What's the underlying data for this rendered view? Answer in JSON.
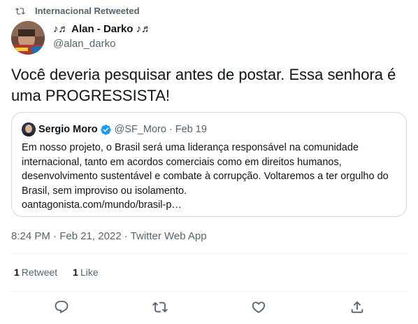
{
  "retweet_context": {
    "text": "Internacional Retweeted"
  },
  "tweet": {
    "author_name": "♪♬ Alan - Darko ♪♬",
    "author_handle": "@alan_darko",
    "text": "Você deveria pesquisar antes de postar. Essa senhora é uma PROGRESSISTA!",
    "timestamp": "8:24 PM · Feb 21, 2022 · Twitter Web App",
    "stats": {
      "retweets_count": "1",
      "retweets_label": "Retweet",
      "likes_count": "1",
      "likes_label": "Like"
    }
  },
  "quoted_tweet": {
    "author_name": "Sergio Moro",
    "author_handle": "@SF_Moro",
    "separator": "·",
    "date": "Feb 19",
    "text": "Em nosso projeto, o Brasil será uma liderança responsável na comunidade internacional, tanto em acordos comerciais como em direitos humanos, desenvolvimento sustentável e combate à corrupção. Voltaremos a ter orgulho do Brasil, sem improviso ou isolamento.",
    "link": "oantagonista.com/mundo/brasil-p…"
  },
  "icons": {
    "retweet_context": "retweet-icon",
    "reply": "reply-icon",
    "retweet": "retweet-icon",
    "like": "heart-icon",
    "share": "share-icon",
    "verified": "verified-badge-icon"
  },
  "colors": {
    "text_primary": "#0f1419",
    "text_secondary": "#536471",
    "border": "#cfd9de",
    "verified_blue": "#1d9bf0"
  }
}
